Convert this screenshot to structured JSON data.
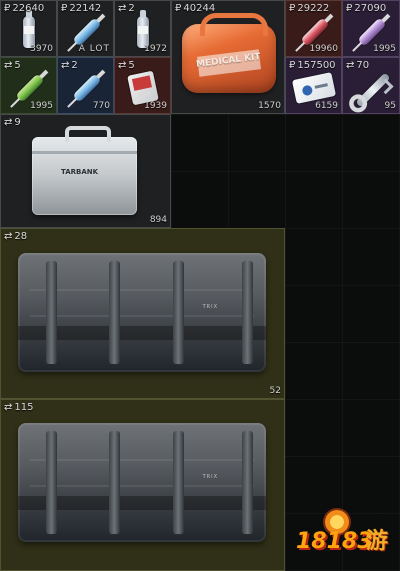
{
  "inventory": {
    "slots": [
      {
        "top": "22640",
        "bottom": "3970",
        "icon": "medicine-bottle-icon",
        "tag": "ruble-icon"
      },
      {
        "top": "22142",
        "bottom": "A LOT",
        "icon": "syringe-icon",
        "tag": "ruble-icon"
      },
      {
        "top": "2",
        "bottom": "1972",
        "icon": "medicine-bottle-icon",
        "tag": "trade-icon"
      },
      {
        "top": "40244",
        "bottom": "1570",
        "icon": "medical-kit-bag-icon",
        "tag": "ruble-icon",
        "label": "MEDICAL KIT"
      },
      {
        "top": "29222",
        "bottom": "19960",
        "icon": "red-syringe-icon",
        "tag": "ruble-icon"
      },
      {
        "top": "27090",
        "bottom": "1995",
        "icon": "purple-syringe-icon",
        "tag": "ruble-icon"
      },
      {
        "top": "5",
        "bottom": "1995",
        "icon": "green-syringe-icon",
        "tag": "trade-icon"
      },
      {
        "top": "2",
        "bottom": "770",
        "icon": "blue-syringe-icon",
        "tag": "trade-icon"
      },
      {
        "top": "5",
        "bottom": "1939",
        "icon": "first-aid-pack-icon",
        "tag": "trade-icon"
      },
      {
        "top": "157500",
        "bottom": "6159",
        "icon": "keycard-icon",
        "tag": "ruble-icon"
      },
      {
        "top": "70",
        "bottom": "95",
        "icon": "key-icon",
        "tag": "trade-icon"
      },
      {
        "top": "9",
        "bottom": "894",
        "icon": "tarbank-case-icon",
        "tag": "trade-icon",
        "label": "TARBANK"
      },
      {
        "top": "28",
        "bottom": "52",
        "icon": "large-case-icon",
        "tag": "trade-icon",
        "label": "TRIX"
      },
      {
        "top": "115",
        "bottom": "",
        "icon": "large-case-icon",
        "tag": "trade-icon",
        "label": "TRIX"
      }
    ],
    "symbols": {
      "ruble": "₽",
      "trade": "⇄"
    }
  },
  "watermark": {
    "number": "18183",
    "tail": "游"
  }
}
